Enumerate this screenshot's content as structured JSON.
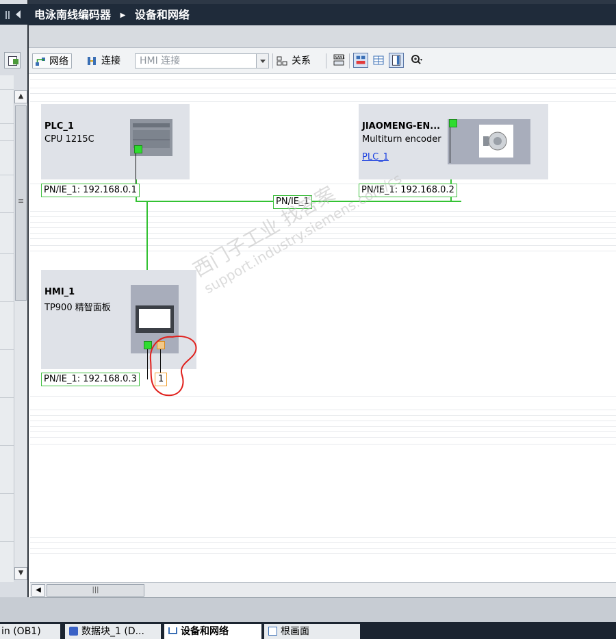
{
  "title_bar": {
    "project": "电泳南线编码器",
    "section": "设备和网络"
  },
  "toolbar": {
    "network_label": "网络",
    "connect_label": "连接",
    "connection_select_value": "HMI 连接",
    "relations_label": "关系"
  },
  "devices": {
    "plc": {
      "name": "PLC_1",
      "type": "CPU 1215C",
      "interface": "PN/IE_1:  192.168.0.1"
    },
    "encoder": {
      "name": "JIAOMENG-EN...",
      "type": "Multiturn encoder",
      "link": "PLC_1",
      "interface": "PN/IE_1:  192.168.0.2"
    },
    "hmi": {
      "name": "HMI_1",
      "type": "TP900 精智面板",
      "interface": "PN/IE_1:  192.168.0.3",
      "second_port": "1"
    }
  },
  "network": {
    "subnet_label": "PN/IE_1"
  },
  "watermark": {
    "line1": "西门子工业  找答案",
    "line2": "support.industry.siemens.com/cs"
  },
  "taskbar": {
    "items": [
      "in (OB1)",
      "数据块_1 (D...",
      "设备和网络",
      "根画面"
    ]
  },
  "colors": {
    "network_green": "#33c233",
    "title_bg": "#1f2b3a",
    "device_bg": "#dfe2e8",
    "link_blue": "#1a3fe0",
    "annotation_red": "#e0201c"
  }
}
